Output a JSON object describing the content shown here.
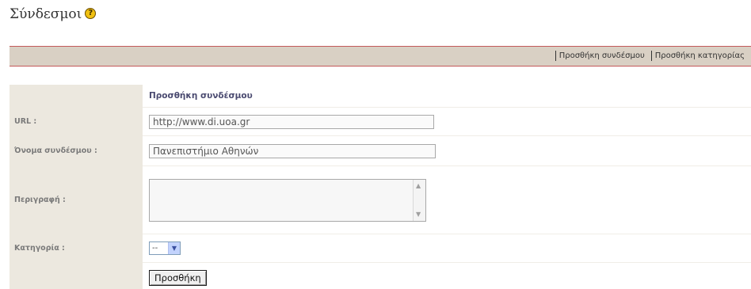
{
  "page": {
    "title": "Σύνδεσμοι",
    "help_icon": "help-icon"
  },
  "toolbar": {
    "links": [
      "Προσθήκη συνδέσμου",
      "Προσθήκη κατηγορίας"
    ]
  },
  "form": {
    "header": "Προσθήκη συνδέσμου",
    "url_label": "URL :",
    "url_value": "http://www.di.uoa.gr",
    "name_label": "Όνομα συνδέσμου :",
    "name_value": "Πανεπιστήμιο Αθηνών",
    "description_label": "Περιγραφή :",
    "description_value": "",
    "category_label": "Κατηγορία :",
    "category_value": "--",
    "submit_label": "Προσθήκη"
  },
  "colors": {
    "toolbar_bg": "#d9d0c4",
    "toolbar_border": "#c45a5a",
    "label_bg": "#ece8df",
    "help_icon": "#f0c010"
  }
}
